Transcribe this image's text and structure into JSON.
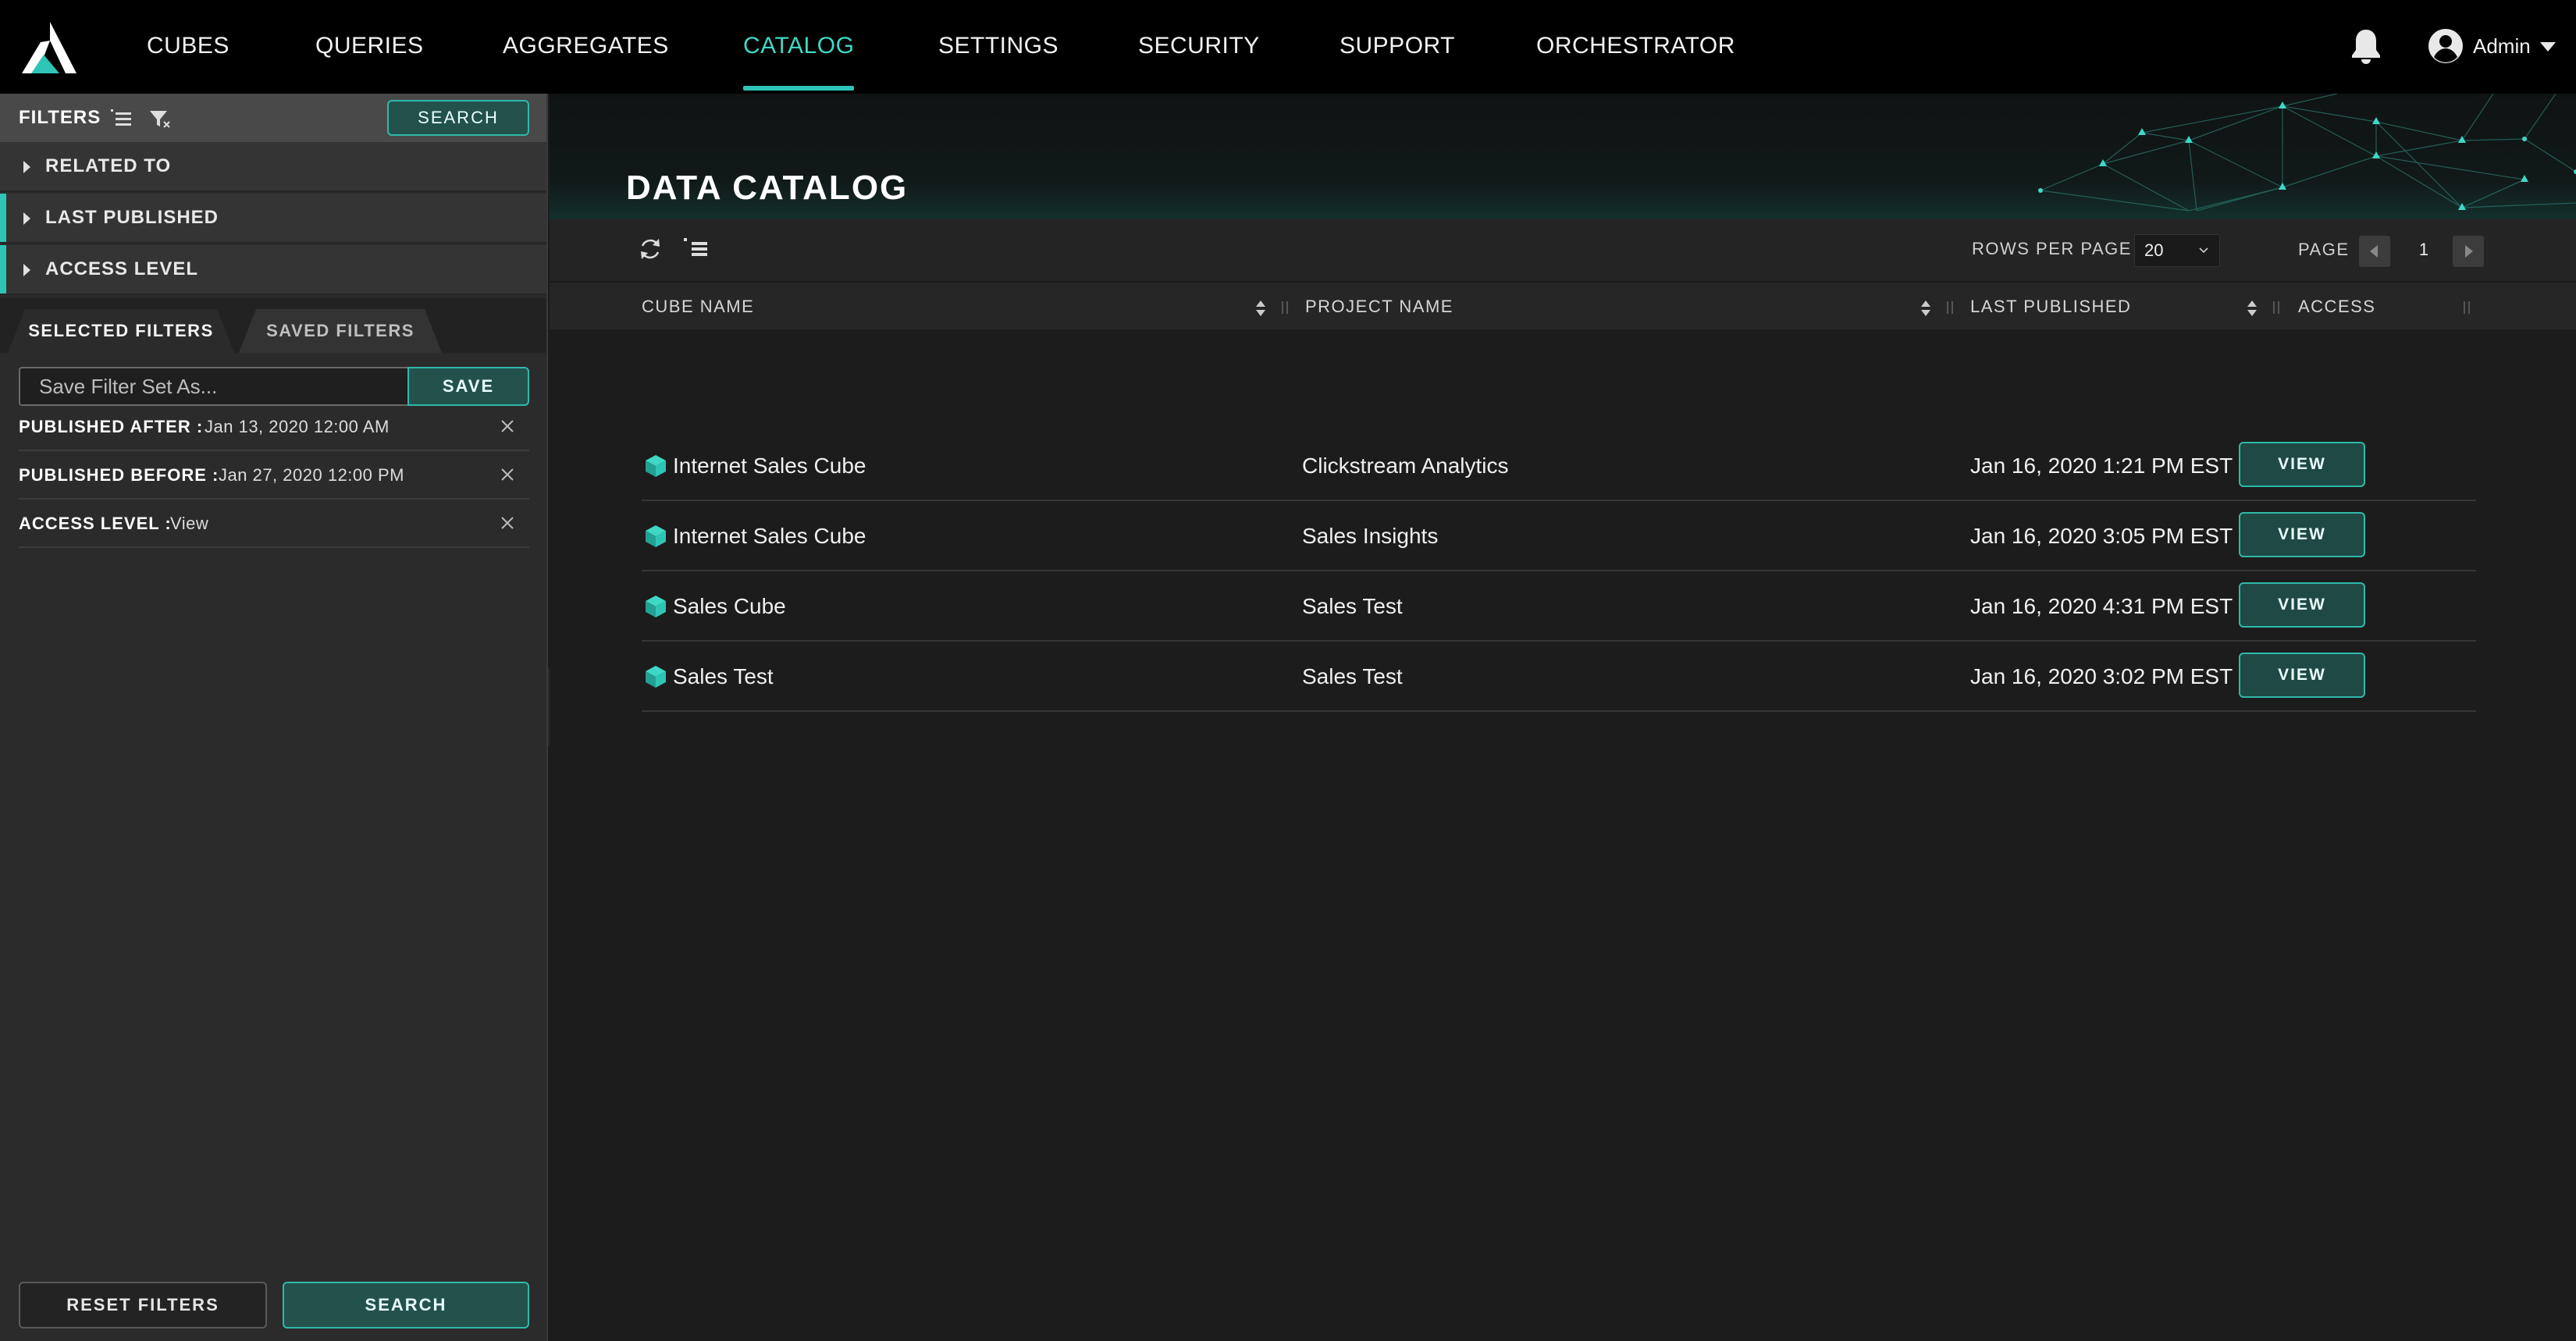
{
  "nav": {
    "items": [
      {
        "label": "CUBES"
      },
      {
        "label": "QUERIES"
      },
      {
        "label": "AGGREGATES"
      },
      {
        "label": "CATALOG"
      },
      {
        "label": "SETTINGS"
      },
      {
        "label": "SECURITY"
      },
      {
        "label": "SUPPORT"
      },
      {
        "label": "ORCHESTRATOR"
      }
    ],
    "active": "CATALOG",
    "user": "Admin",
    "icons": {
      "logo": "triangle-logo-icon",
      "notifications": "bell-icon",
      "user": "user-avatar-icon",
      "menu": "caret-down-icon"
    }
  },
  "sidebar": {
    "title": "FILTERS",
    "search_label": "SEARCH",
    "sections": [
      {
        "label": "RELATED TO"
      },
      {
        "label": "LAST PUBLISHED"
      },
      {
        "label": "ACCESS LEVEL"
      }
    ],
    "tabs": {
      "selected": "SELECTED FILTERS",
      "saved": "SAVED FILTERS"
    },
    "save_placeholder": "Save Filter Set As...",
    "save_label": "SAVE",
    "selected_filters": [
      {
        "key": "PUBLISHED AFTER :",
        "value": "Jan 13, 2020 12:00 AM"
      },
      {
        "key": "PUBLISHED BEFORE :",
        "value": "Jan 27, 2020 12:00 PM"
      },
      {
        "key": "ACCESS LEVEL :",
        "value": "View"
      }
    ],
    "reset_label": "RESET FILTERS",
    "search_bottom_label": "SEARCH"
  },
  "main": {
    "title": "DATA CATALOG",
    "rows_per_page_label": "ROWS PER PAGE",
    "rows_per_page": "20",
    "page_label": "PAGE",
    "page": "1",
    "columns": [
      "CUBE NAME",
      "PROJECT NAME",
      "LAST PUBLISHED",
      "ACCESS"
    ],
    "rows": [
      {
        "cube": "Internet Sales Cube",
        "project": "Clickstream Analytics",
        "published": "Jan 16, 2020 1:21 PM EST",
        "access": "VIEW"
      },
      {
        "cube": "Internet Sales Cube",
        "project": "Sales Insights",
        "published": "Jan 16, 2020 3:05 PM EST",
        "access": "VIEW"
      },
      {
        "cube": "Sales Cube",
        "project": "Sales Test",
        "published": "Jan 16, 2020 4:31 PM EST",
        "access": "VIEW"
      },
      {
        "cube": "Sales Test",
        "project": "Sales Test",
        "published": "Jan 16, 2020 3:02 PM EST",
        "access": "VIEW"
      }
    ]
  },
  "colors": {
    "accent": "#2ec5b6",
    "nav_bg": "#000000",
    "panel_bg": "#2b2b2b",
    "content_bg": "#1c1c1c"
  }
}
